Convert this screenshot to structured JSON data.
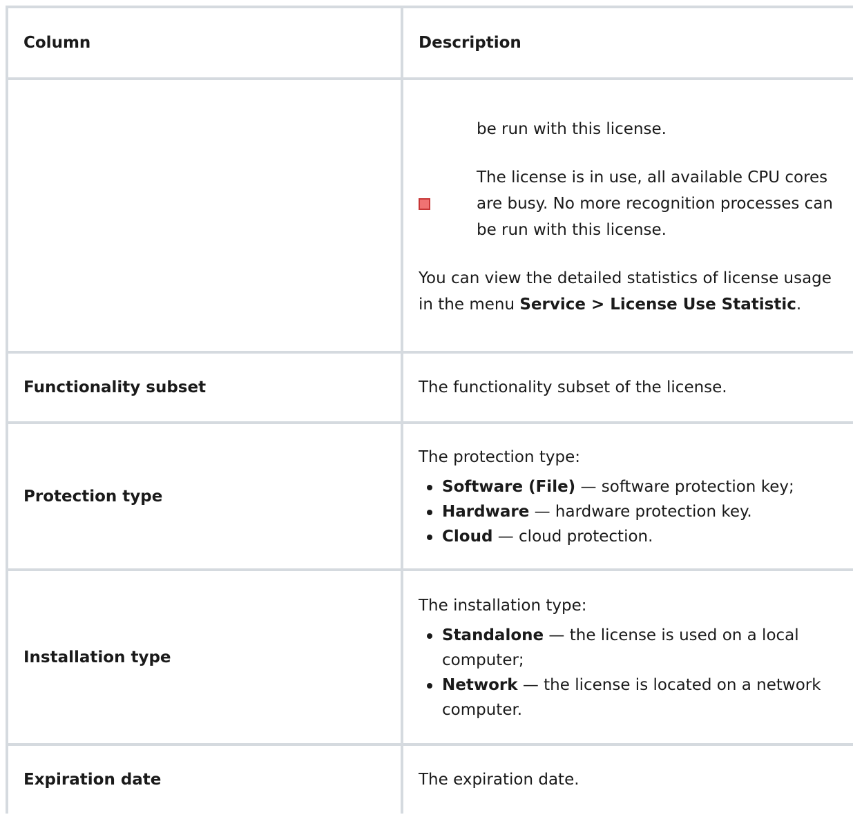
{
  "table": {
    "headers": {
      "column": "Column",
      "description": "Description"
    },
    "status_row": {
      "status_tail": "be run with this license.",
      "status_busy": "The license is in use, all available CPU cores are busy. No more recognition processes can be run with this license.",
      "status_busy_color": "#f07272",
      "note_prefix": "You can view the detailed statistics of license usage in the menu ",
      "note_menu_path": "Service > License Use Statistic",
      "note_suffix": "."
    },
    "rows": [
      {
        "name": "Functionality subset",
        "description": "The functionality subset of the license."
      },
      {
        "name": "Protection type",
        "intro": "The protection type:",
        "items": [
          {
            "term": "Software (File)",
            "text": " — software protection key;"
          },
          {
            "term": "Hardware",
            "text": " — hardware protection key."
          },
          {
            "term": "Cloud",
            "text": " — cloud protection."
          }
        ]
      },
      {
        "name": "Installation type",
        "intro": "The installation type:",
        "items": [
          {
            "term": "Standalone",
            "text": " — the license is used on a local computer;"
          },
          {
            "term": "Network",
            "text": " — the license is located on a network computer."
          }
        ]
      },
      {
        "name": "Expiration date",
        "description": "The expiration date."
      }
    ]
  }
}
